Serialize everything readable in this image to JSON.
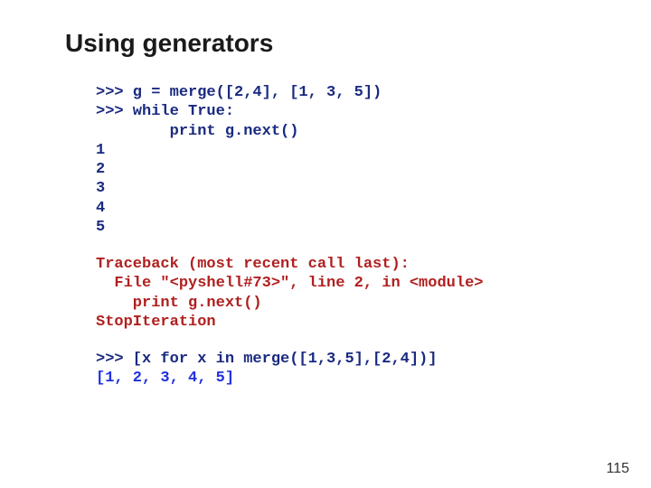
{
  "title": "Using generators",
  "block1": {
    "l1": ">>> g = merge([2,4], [1, 3, 5])",
    "l2": ">>> while True:",
    "l3": "        print g.next()",
    "l4": "1",
    "l5": "2",
    "l6": "3",
    "l7": "4",
    "l8": "5"
  },
  "block2": {
    "l1": "Traceback (most recent call last):",
    "l2": "  File \"<pyshell#73>\", line 2, in <module>",
    "l3": "    print g.next()",
    "l4": "StopIteration"
  },
  "block3": {
    "l1": ">>> [x for x in merge([1,3,5],[2,4])]",
    "l2": "[1, 2, 3, 4, 5]"
  },
  "pageNumber": "115"
}
